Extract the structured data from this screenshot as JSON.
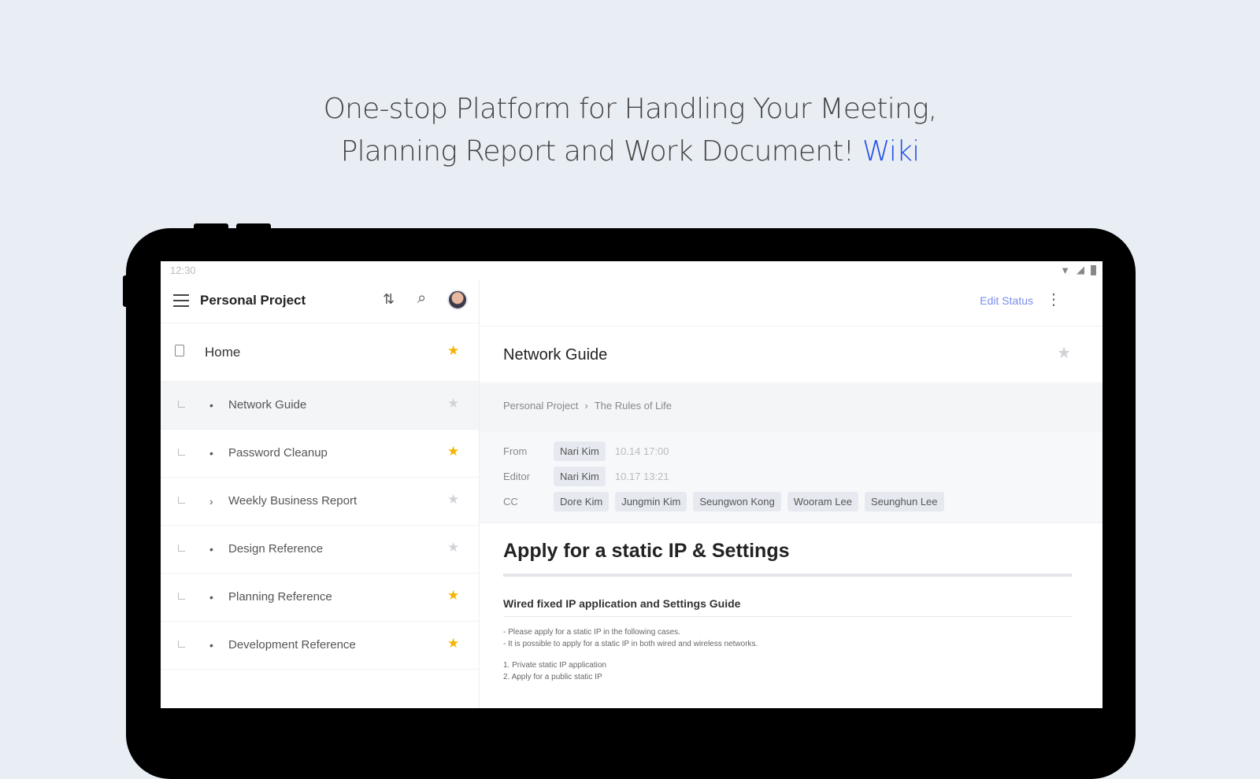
{
  "headline": {
    "line1": "One-stop Platform for Handling  Your Meeting,",
    "line2": "Planning Report  and Work Document!",
    "accent": "Wiki",
    "accent_color": "#2452e6"
  },
  "statusbar": {
    "time": "12:30",
    "icons": [
      "wifi-icon",
      "signal-icon",
      "battery-icon"
    ]
  },
  "sidebar": {
    "title": "Personal Project",
    "toolbar_icons": [
      "menu-icon",
      "sort-icon",
      "search-icon",
      "avatar"
    ],
    "home": {
      "label": "Home",
      "starred": true
    },
    "items": [
      {
        "label": "Network Guide",
        "marker": "•",
        "starred": false,
        "active": true
      },
      {
        "label": "Password Cleanup",
        "marker": "•",
        "starred": true
      },
      {
        "label": "Weekly Business Report",
        "marker": "›",
        "starred": false
      },
      {
        "label": "Design Reference",
        "marker": "•",
        "starred": false
      },
      {
        "label": "Planning Reference",
        "marker": "•",
        "starred": true
      },
      {
        "label": "Development Reference",
        "marker": "•",
        "starred": true
      }
    ]
  },
  "main": {
    "edit_status": "Edit Status",
    "doc_title": "Network Guide",
    "breadcrumb": [
      "Personal Project",
      "The Rules of Life"
    ],
    "meta": {
      "from_label": "From",
      "from_name": "Nari Kim",
      "from_time": "10.14 17:00",
      "editor_label": "Editor",
      "editor_name": "Nari Kim",
      "editor_time": "10.17 13:21",
      "cc_label": "CC",
      "cc": [
        "Dore Kim",
        "Jungmin Kim",
        "Seungwon Kong",
        "Wooram Lee",
        "Seunghun Lee"
      ]
    },
    "content": {
      "heading": "Apply for a static IP & Settings",
      "subheading": "Wired fixed IP application and Settings Guide",
      "bullets": [
        "- Please apply for a static IP in the following cases.",
        "- It is possible to apply for a static IP in both wired and wireless networks."
      ],
      "steps": [
        "1. Private static IP application",
        "2. Apply for a public static IP"
      ]
    }
  }
}
